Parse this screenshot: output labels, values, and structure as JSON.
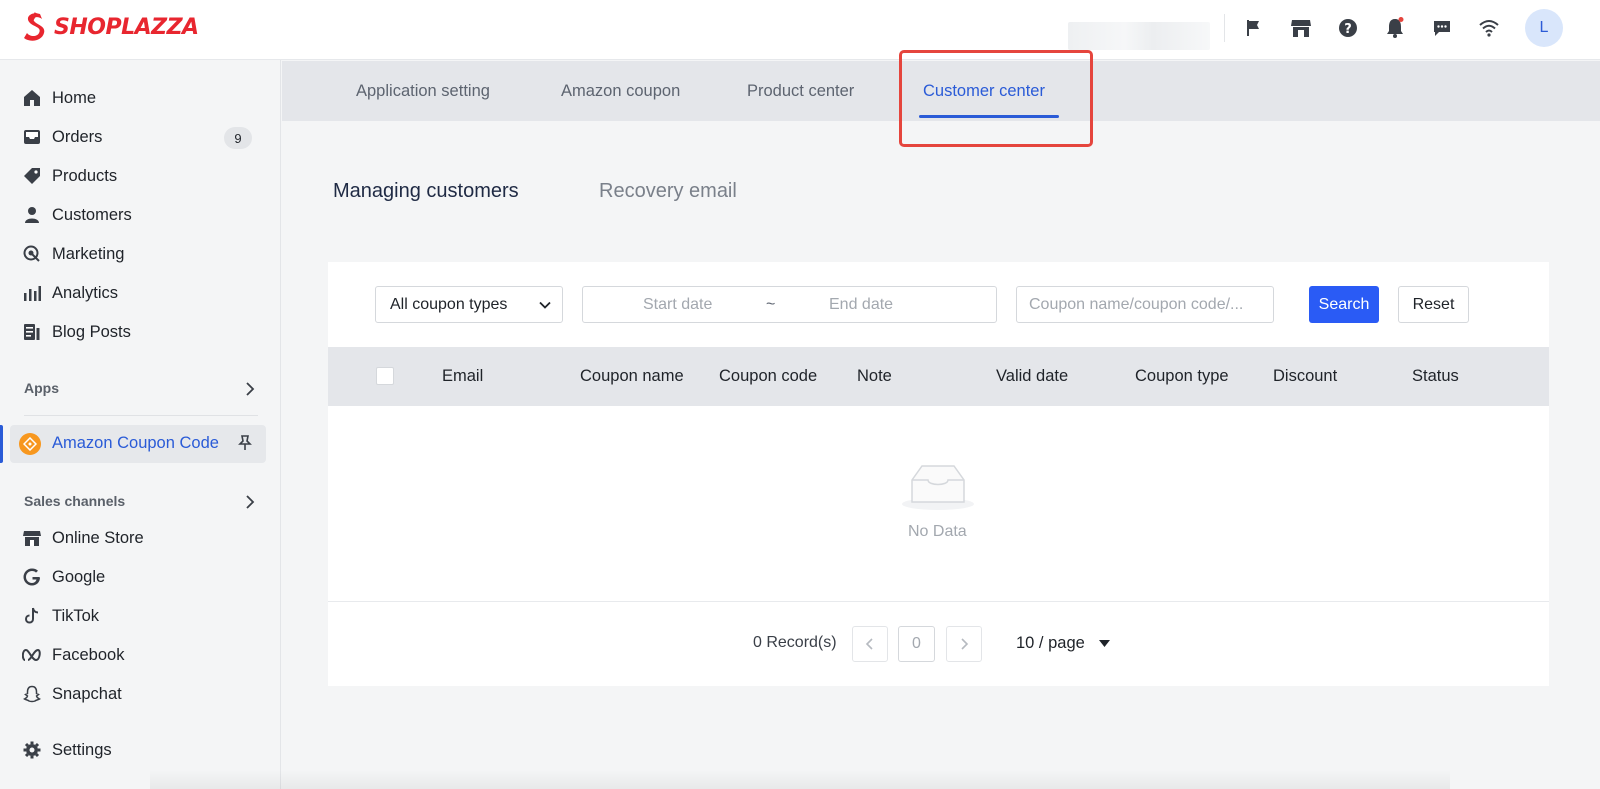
{
  "brand": {
    "name": "SHOPLAZZA",
    "color": "#e8262f"
  },
  "header": {
    "avatar_initial": "L",
    "icons": [
      "flag-icon",
      "store-icon",
      "help-icon",
      "bell-icon",
      "chat-icon",
      "wifi-icon"
    ]
  },
  "sidebar": {
    "items": [
      {
        "label": "Home",
        "icon": "home-icon"
      },
      {
        "label": "Orders",
        "icon": "inbox-icon",
        "badge": "9"
      },
      {
        "label": "Products",
        "icon": "tag-icon"
      },
      {
        "label": "Customers",
        "icon": "person-icon"
      },
      {
        "label": "Marketing",
        "icon": "target-icon"
      },
      {
        "label": "Analytics",
        "icon": "bar-chart-icon"
      },
      {
        "label": "Blog Posts",
        "icon": "document-icon"
      }
    ],
    "apps_label": "Apps",
    "active_app": {
      "label": "Amazon Coupon Code",
      "icon": "coupon-app-icon"
    },
    "sales_channels_label": "Sales channels",
    "channels": [
      {
        "label": "Online Store",
        "icon": "store-icon"
      },
      {
        "label": "Google",
        "icon": "google-icon"
      },
      {
        "label": "TikTok",
        "icon": "tiktok-icon"
      },
      {
        "label": "Facebook",
        "icon": "meta-icon"
      },
      {
        "label": "Snapchat",
        "icon": "ghost-icon"
      }
    ],
    "settings_label": "Settings"
  },
  "tabs": [
    {
      "label": "Application setting"
    },
    {
      "label": "Amazon coupon"
    },
    {
      "label": "Product center"
    },
    {
      "label": "Customer center",
      "active": true
    }
  ],
  "subtabs": [
    {
      "label": "Managing customers",
      "active": true
    },
    {
      "label": "Recovery email"
    }
  ],
  "filters": {
    "coupon_type": "All coupon types",
    "start_placeholder": "Start date",
    "range_sep": "~",
    "end_placeholder": "End date",
    "search_placeholder": "Coupon name/coupon code/...",
    "search_label": "Search",
    "reset_label": "Reset"
  },
  "table": {
    "columns": [
      "Email",
      "Coupon name",
      "Coupon code",
      "Note",
      "Valid date",
      "Coupon type",
      "Discount",
      "Status"
    ],
    "empty_text": "No Data"
  },
  "pagination": {
    "records": "0 Record(s)",
    "current": "0",
    "page_size": "10 / page"
  },
  "colors": {
    "accent": "#2a5bd7",
    "primary_button": "#2a5bf5",
    "highlight": "#e5453d"
  }
}
